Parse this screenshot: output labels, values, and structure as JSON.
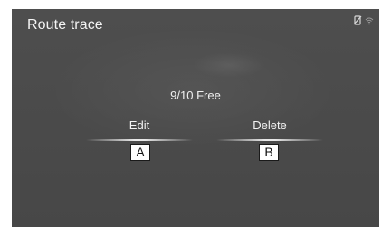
{
  "screen": {
    "title": "Route trace",
    "status_icons": [
      "no-phone-icon",
      "wifi-icon"
    ]
  },
  "memory": {
    "free_text": "9/10 Free"
  },
  "buttons": {
    "edit_label": "Edit",
    "delete_label": "Delete"
  },
  "callouts": {
    "a": "A",
    "b": "B"
  },
  "colors": {
    "screen_background": "#4b4b4b",
    "text": "#f2f2f2"
  }
}
